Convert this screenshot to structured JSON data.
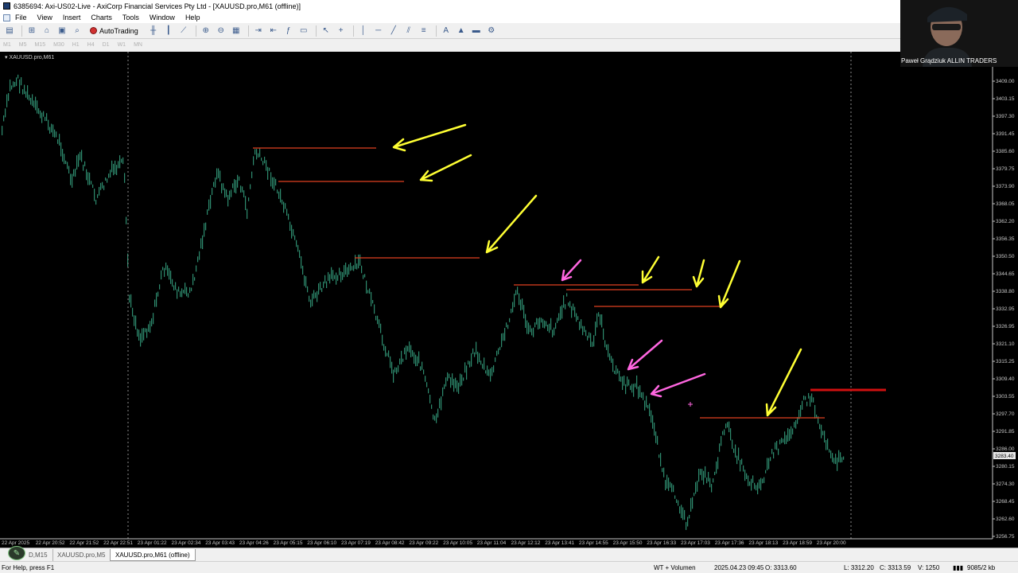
{
  "window": {
    "title": "6385694: Axi-US02-Live - AxiCorp Financial Services Pty Ltd - [XAUUSD.pro,M61 (offline)]"
  },
  "menu": {
    "items": [
      "File",
      "View",
      "Insert",
      "Charts",
      "Tools",
      "Window",
      "Help"
    ]
  },
  "toolbar": {
    "autotrading_label": "AutoTrading"
  },
  "periods": [
    "M1",
    "M5",
    "M15",
    "M30",
    "H1",
    "H4",
    "D1",
    "W1",
    "MN"
  ],
  "chart": {
    "symbol_label": "XAUUSD.pro,M61",
    "current_price": "3283.40",
    "price_ticks": [
      "3409.00",
      "3403.15",
      "3397.30",
      "3391.45",
      "3385.60",
      "3379.75",
      "3373.90",
      "3368.05",
      "3362.20",
      "3356.35",
      "3350.50",
      "3344.65",
      "3338.80",
      "3332.95",
      "3326.95",
      "3321.10",
      "3315.25",
      "3309.40",
      "3303.55",
      "3297.70",
      "3291.85",
      "3286.00",
      "3280.15",
      "3274.30",
      "3268.45",
      "3262.60",
      "3256.75"
    ],
    "time_ticks": [
      "22 Apr 2025",
      "22 Apr 20:52",
      "22 Apr 21:52",
      "22 Apr 22:51",
      "23 Apr 01:22",
      "23 Apr 02:34",
      "23 Apr 03:43",
      "23 Apr 04:26",
      "23 Apr 05:15",
      "23 Apr 06:10",
      "23 Apr 07:19",
      "23 Apr 08:42",
      "23 Apr 09:22",
      "23 Apr 10:05",
      "23 Apr 11:04",
      "23 Apr 12:12",
      "23 Apr 13:41",
      "23 Apr 14:55",
      "23 Apr 15:50",
      "23 Apr 16:33",
      "23 Apr 17:03",
      "23 Apr 17:36",
      "23 Apr 18:13",
      "23 Apr 18:59",
      "23 Apr 20:00"
    ],
    "colors": {
      "background": "#000000",
      "candle": "#2e8b6e",
      "level_line": "#e04020",
      "arrow_yellow": "#ffff33",
      "arrow_pink": "#ff66e0",
      "axis_text": "#c8c8c8"
    }
  },
  "webcam": {
    "caption": "Paweł Grądziuk ALLIN TRADERS"
  },
  "tabs": [
    {
      "label": "D,M15",
      "active": false
    },
    {
      "label": "XAUUSD.pro,M5",
      "active": false
    },
    {
      "label": "XAUUSD.pro,M61 (offline)",
      "active": true
    }
  ],
  "status": {
    "help": "For Help, press F1",
    "profile": "WT + Volumen",
    "datetime": "2025.04.23 09:45",
    "open": "O: 3313.60",
    "low": "L: 3312.20",
    "close": "C: 3313.59",
    "volume": "V: 1250",
    "traffic": "9085/2 kb"
  }
}
